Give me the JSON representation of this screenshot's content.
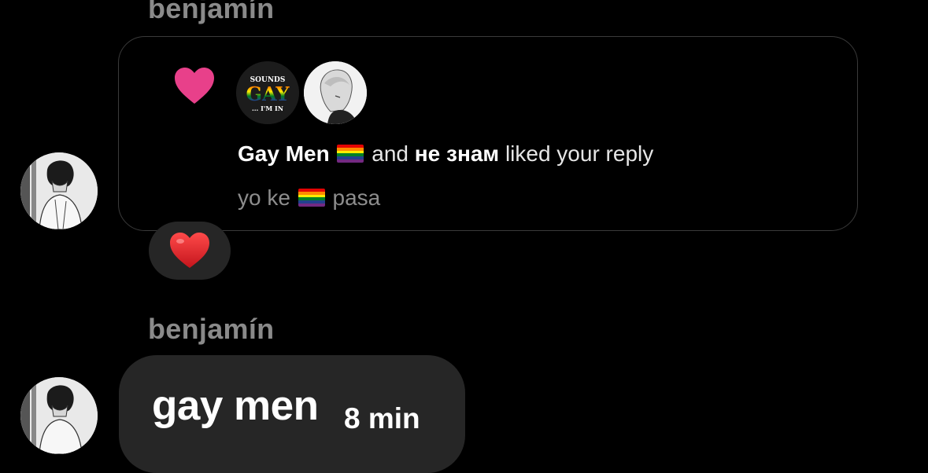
{
  "thread": {
    "sender_name_top": "benjamín",
    "sender_name_bottom": "benjamín"
  },
  "notification": {
    "heart_icon": "heart-icon",
    "heart_color": "#e8408a",
    "liker_1_badge_line1": "SOUNDS",
    "liker_1_badge_line2": "GAY",
    "liker_1_badge_line3": "... I'M IN",
    "liker_1_name": "Gay Men",
    "connector": "and",
    "liker_2_name": "не знам",
    "action_text": "liked your reply",
    "reply_before_flag": "yo ke",
    "reply_after_flag": "pasa",
    "flag_icon": "rainbow-flag-icon"
  },
  "reaction": {
    "emoji_icon": "red-heart-icon",
    "color": "#e0262b"
  },
  "message": {
    "text": "gay men",
    "time": "8 min"
  },
  "colors": {
    "background": "#000000",
    "bubble": "#262626",
    "muted_text": "#8a8a8a"
  }
}
